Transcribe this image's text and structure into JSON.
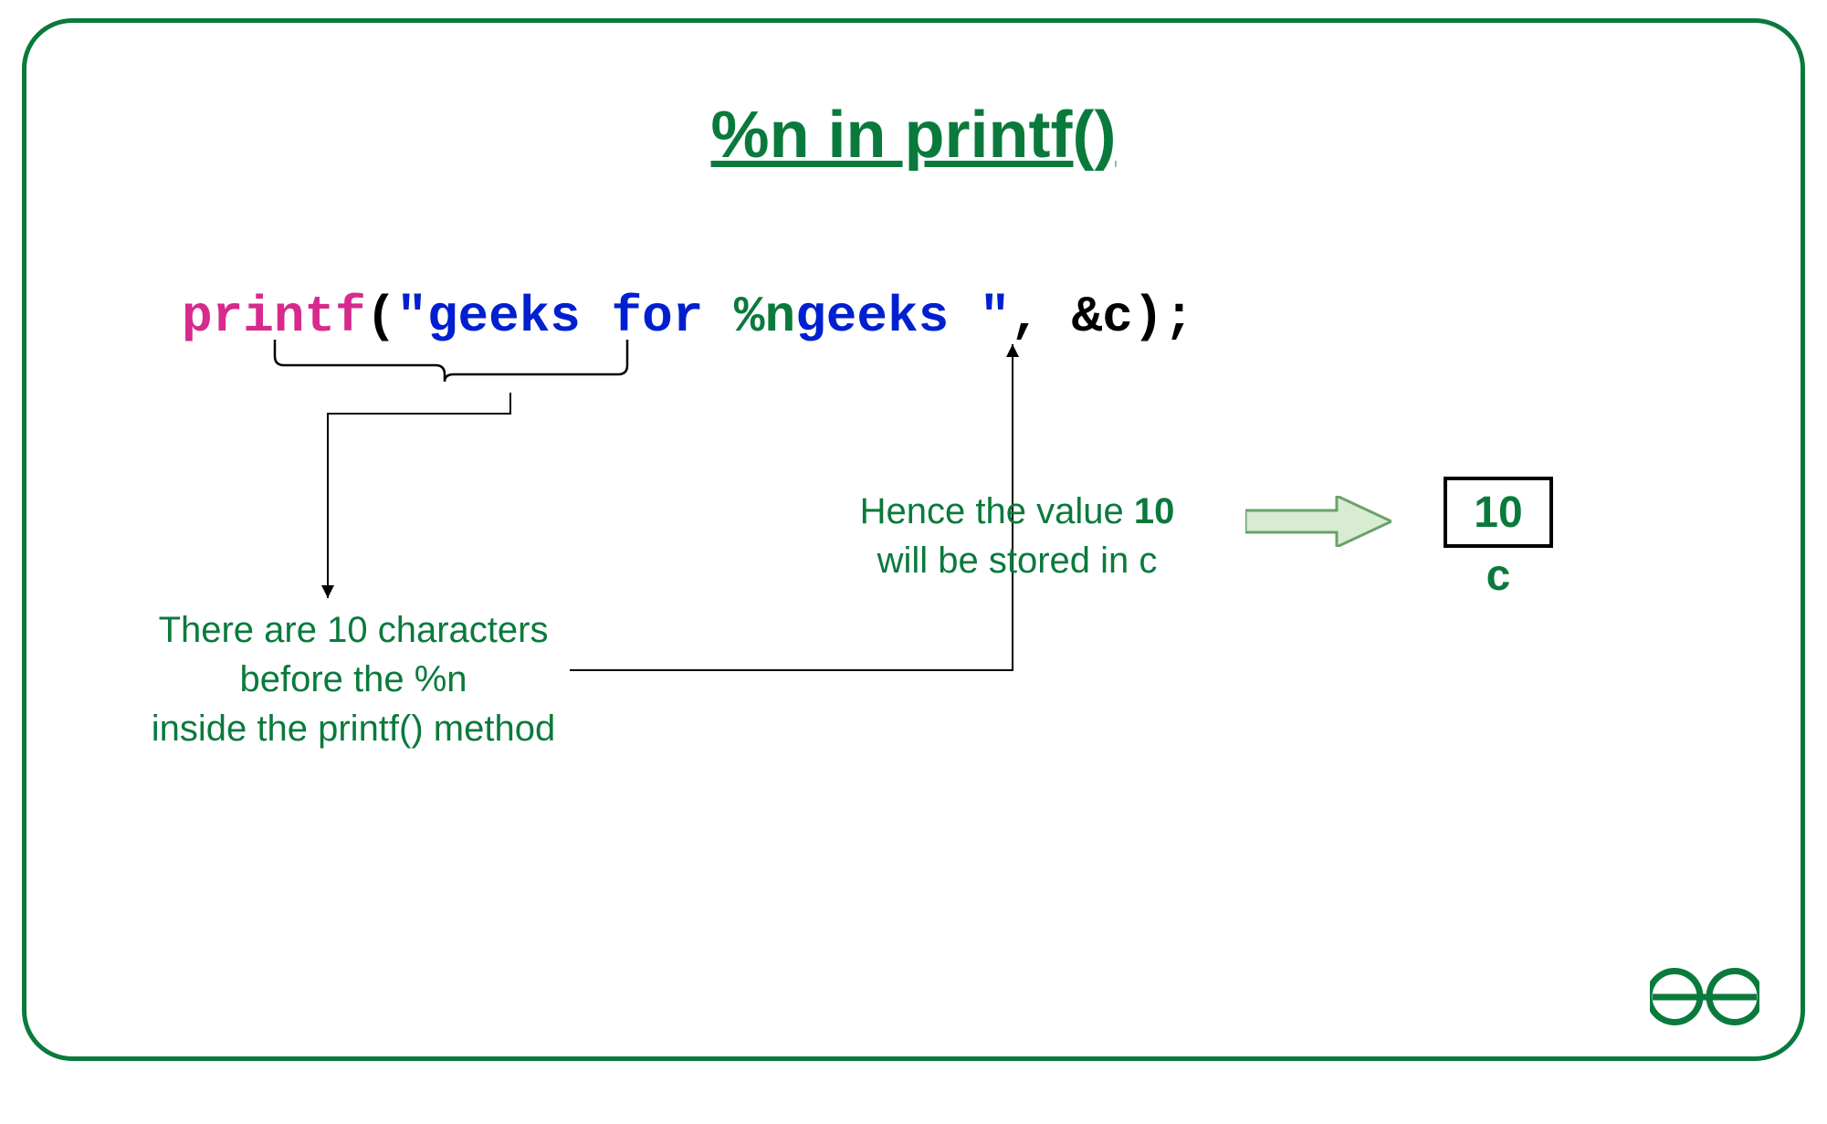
{
  "title": "%n in printf()",
  "code": {
    "printf": "printf",
    "open": "(",
    "quote1": "\"",
    "str1": "geeks for ",
    "fmt": "%n",
    "str2": "geeks ",
    "quote2": "\"",
    "rest": ", &c);"
  },
  "note1": {
    "l1": "There are 10 characters",
    "l2": "before the %n",
    "l3": "inside the printf() method"
  },
  "note2": {
    "pre": "Hence the value ",
    "val": "10",
    "l2": "will be stored in c"
  },
  "result": {
    "value": "10",
    "var": "c"
  },
  "colors": {
    "accent": "#0a7a3c",
    "pink": "#d62a8d",
    "blue": "#0020d0"
  }
}
